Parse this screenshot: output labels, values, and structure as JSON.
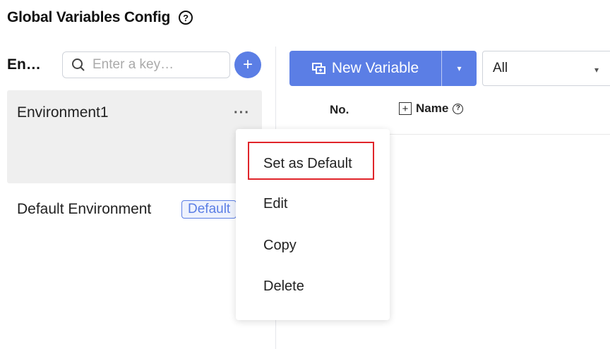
{
  "page": {
    "title": "Global Variables Config",
    "help_icon": "?"
  },
  "env_panel": {
    "label": "En…",
    "search": {
      "placeholder": "Enter a key…",
      "value": ""
    },
    "add_icon": "+",
    "items": [
      {
        "label": "Environment1",
        "more_icon": "···"
      },
      {
        "label": "Default Environment",
        "badge": "Default"
      }
    ]
  },
  "toolbar": {
    "new_variable_label": "New Variable",
    "dropdown_icon": "▾",
    "filter": {
      "selected": "All",
      "caret_icon": "▾"
    }
  },
  "table": {
    "columns": [
      {
        "label": "No."
      },
      {
        "label": "Name",
        "expand_icon": "+",
        "help_icon": "?"
      }
    ]
  },
  "context_menu": {
    "items": [
      "Set as Default",
      "Edit",
      "Copy",
      "Delete"
    ],
    "highlighted": "Set as Default"
  },
  "colors": {
    "accent": "#5b7ee5",
    "highlight": "#e0242a",
    "selected_row": "#efefef"
  }
}
